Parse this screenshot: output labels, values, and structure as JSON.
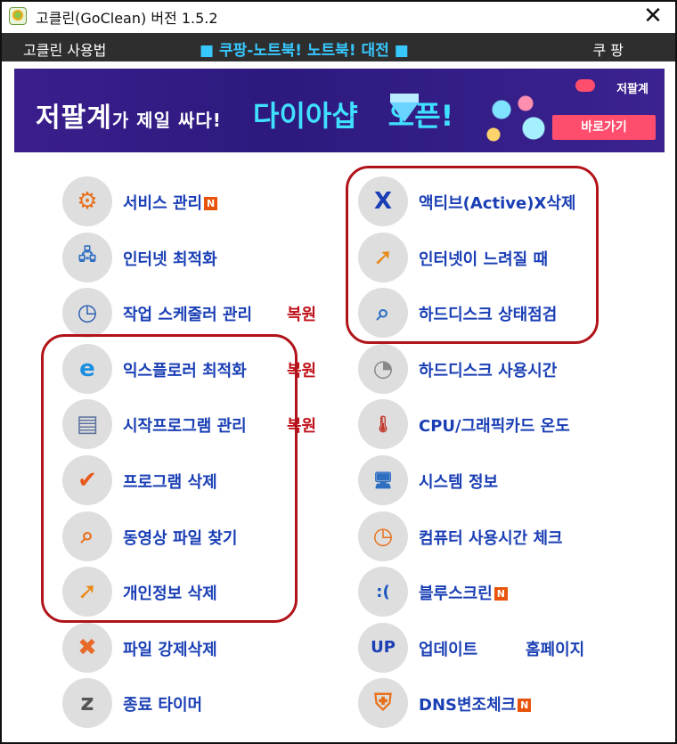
{
  "window": {
    "title": "고클린(GoClean) 버전 1.5.2",
    "close_symbol": "✕"
  },
  "menu": {
    "guide": "고클린 사용법",
    "promo": "■ 쿠팡-노트북! 노트북! 대전 ■",
    "coupang": "쿠 팡"
  },
  "banner": {
    "headline_main": "저팔계",
    "headline_rest": "가 제일 싸다!",
    "headline_accent": "다이아샵",
    "headline_open": "오픈!",
    "brand": "저팔계",
    "button": "바로가기"
  },
  "badge_letter": "N",
  "left_items": [
    {
      "label": "서비스 관리",
      "icon": "gear-icon",
      "badge": true
    },
    {
      "label": "인터넷 최적화",
      "icon": "network-computer-icon"
    },
    {
      "label": "작업 스케줄러 관리",
      "icon": "scheduler-clock-icon",
      "restore": "복원"
    },
    {
      "label": "익스플로러 최적화",
      "icon": "internet-explorer-icon",
      "restore": "복원"
    },
    {
      "label": "시작프로그램 관리",
      "icon": "document-icon",
      "restore": "복원"
    },
    {
      "label": "프로그램 삭제",
      "icon": "uninstall-check-icon"
    },
    {
      "label": "동영상 파일 찾기",
      "icon": "magnifier-icon"
    },
    {
      "label": "개인정보 삭제",
      "icon": "privacy-arrow-icon"
    },
    {
      "label": "파일 강제삭제",
      "icon": "delete-x-icon"
    },
    {
      "label": "종료 타이머",
      "icon": "sleep-bulb-icon"
    }
  ],
  "right_items": [
    {
      "label": "액티브(Active)X삭제",
      "icon": "activex-icon"
    },
    {
      "label": "인터넷이 느려질 때",
      "icon": "slow-internet-arrow-icon"
    },
    {
      "label": "하드디스크 상태점검",
      "icon": "disk-inspect-icon"
    },
    {
      "label": "하드디스크 사용시간",
      "icon": "disk-clock-icon"
    },
    {
      "label": "CPU/그래픽카드 온도",
      "icon": "thermometer-icon"
    },
    {
      "label": "시스템 정보",
      "icon": "computer-icon"
    },
    {
      "label": "컴퓨터 사용시간 체크",
      "icon": "clock-icon"
    },
    {
      "label": "블루스크린",
      "icon": "blue-screen-icon",
      "badge": true
    },
    {
      "label": "업데이트",
      "icon": "update-up-icon",
      "homepage": "홈페이지"
    },
    {
      "label": "DNS변조체크",
      "icon": "shield-icon",
      "badge": true
    }
  ],
  "colors": {
    "label": "#1a3fb5",
    "restore": "#c0121a",
    "group_box": "#b0141a",
    "badge": "#e8540c",
    "menubar": "#2e2e2e",
    "promo": "#37c8ff"
  }
}
